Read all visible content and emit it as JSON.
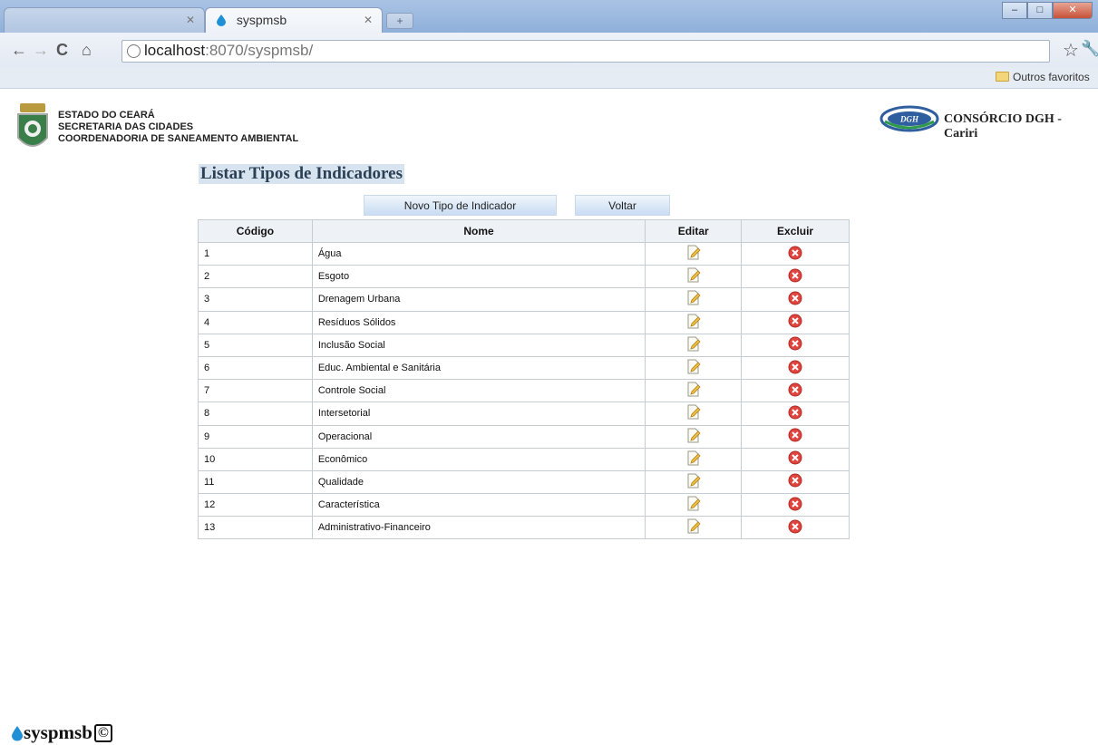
{
  "browser": {
    "tab_active_title": "syspmsb",
    "tab_inactive_title": "",
    "url_host": "localhost",
    "url_path": ":8070/syspmsb/",
    "bookmark_folder": "Outros favoritos"
  },
  "header": {
    "org_line1": "ESTADO DO CEARÁ",
    "org_line2": "SECRETARIA DAS CIDADES",
    "org_line3": "COORDENADORIA DE SANEAMENTO AMBIENTAL",
    "partner_logo_text": "DGH",
    "partner_name": "CONSÓRCIO DGH - Cariri"
  },
  "page": {
    "title": "Listar Tipos de Indicadores",
    "new_button": "Novo Tipo de Indicador",
    "back_button": "Voltar"
  },
  "table": {
    "headers": [
      "Código",
      "Nome",
      "Editar",
      "Excluir"
    ],
    "rows": [
      {
        "codigo": "1",
        "nome": "Água"
      },
      {
        "codigo": "2",
        "nome": "Esgoto"
      },
      {
        "codigo": "3",
        "nome": "Drenagem Urbana"
      },
      {
        "codigo": "4",
        "nome": "Resíduos Sólidos"
      },
      {
        "codigo": "5",
        "nome": "Inclusão Social"
      },
      {
        "codigo": "6",
        "nome": "Educ. Ambiental e Sanitária"
      },
      {
        "codigo": "7",
        "nome": "Controle Social"
      },
      {
        "codigo": "8",
        "nome": "Intersetorial"
      },
      {
        "codigo": "9",
        "nome": "Operacional"
      },
      {
        "codigo": "10",
        "nome": "Econômico"
      },
      {
        "codigo": "11",
        "nome": "Qualidade"
      },
      {
        "codigo": "12",
        "nome": "Característica"
      },
      {
        "codigo": "13",
        "nome": "Administrativo-Financeiro"
      }
    ],
    "edit_icon": "edit-pencil-icon",
    "delete_icon": "delete-x-icon"
  },
  "footer": {
    "brand": "syspmsb",
    "copyright_symbol": "©"
  },
  "colors": {
    "title_bg": "#d7e3ef",
    "delete_red": "#e0443e",
    "button_blue": "#c8dcf2"
  }
}
